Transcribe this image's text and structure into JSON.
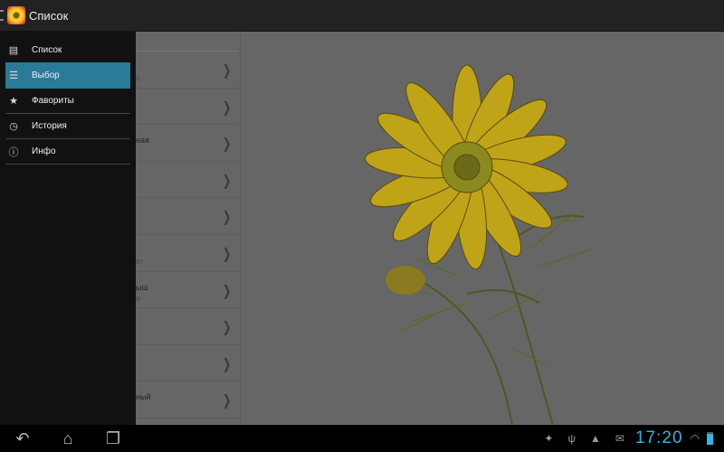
{
  "actionbar": {
    "title": "Список",
    "app_icon": "sunflower-icon"
  },
  "drawer": {
    "items": [
      {
        "label": "Список",
        "icon": "list-icon"
      },
      {
        "label": "Выбор",
        "icon": "filter-icon",
        "selected": true
      },
      {
        "label": "Фавориты",
        "icon": "star-icon"
      },
      {
        "label": "История",
        "icon": "clock-icon"
      },
      {
        "label": "Инфо",
        "icon": "info-icon"
      }
    ]
  },
  "list": {
    "rows": [
      {
        "title": "",
        "subtitle": "s"
      },
      {
        "title": "",
        "subtitle": ""
      },
      {
        "title": "ная",
        "subtitle": ""
      },
      {
        "title": "",
        "subtitle": ""
      },
      {
        "title": "",
        "subtitle": ""
      },
      {
        "title": "",
        "subtitle": "er"
      },
      {
        "title": "ыш",
        "subtitle": "e"
      },
      {
        "title": "",
        "subtitle": ""
      },
      {
        "title": "",
        "subtitle": ""
      },
      {
        "title": "ный",
        "subtitle": ""
      }
    ]
  },
  "statusbar": {
    "time": "17:20",
    "accent": "#33b5e5"
  }
}
